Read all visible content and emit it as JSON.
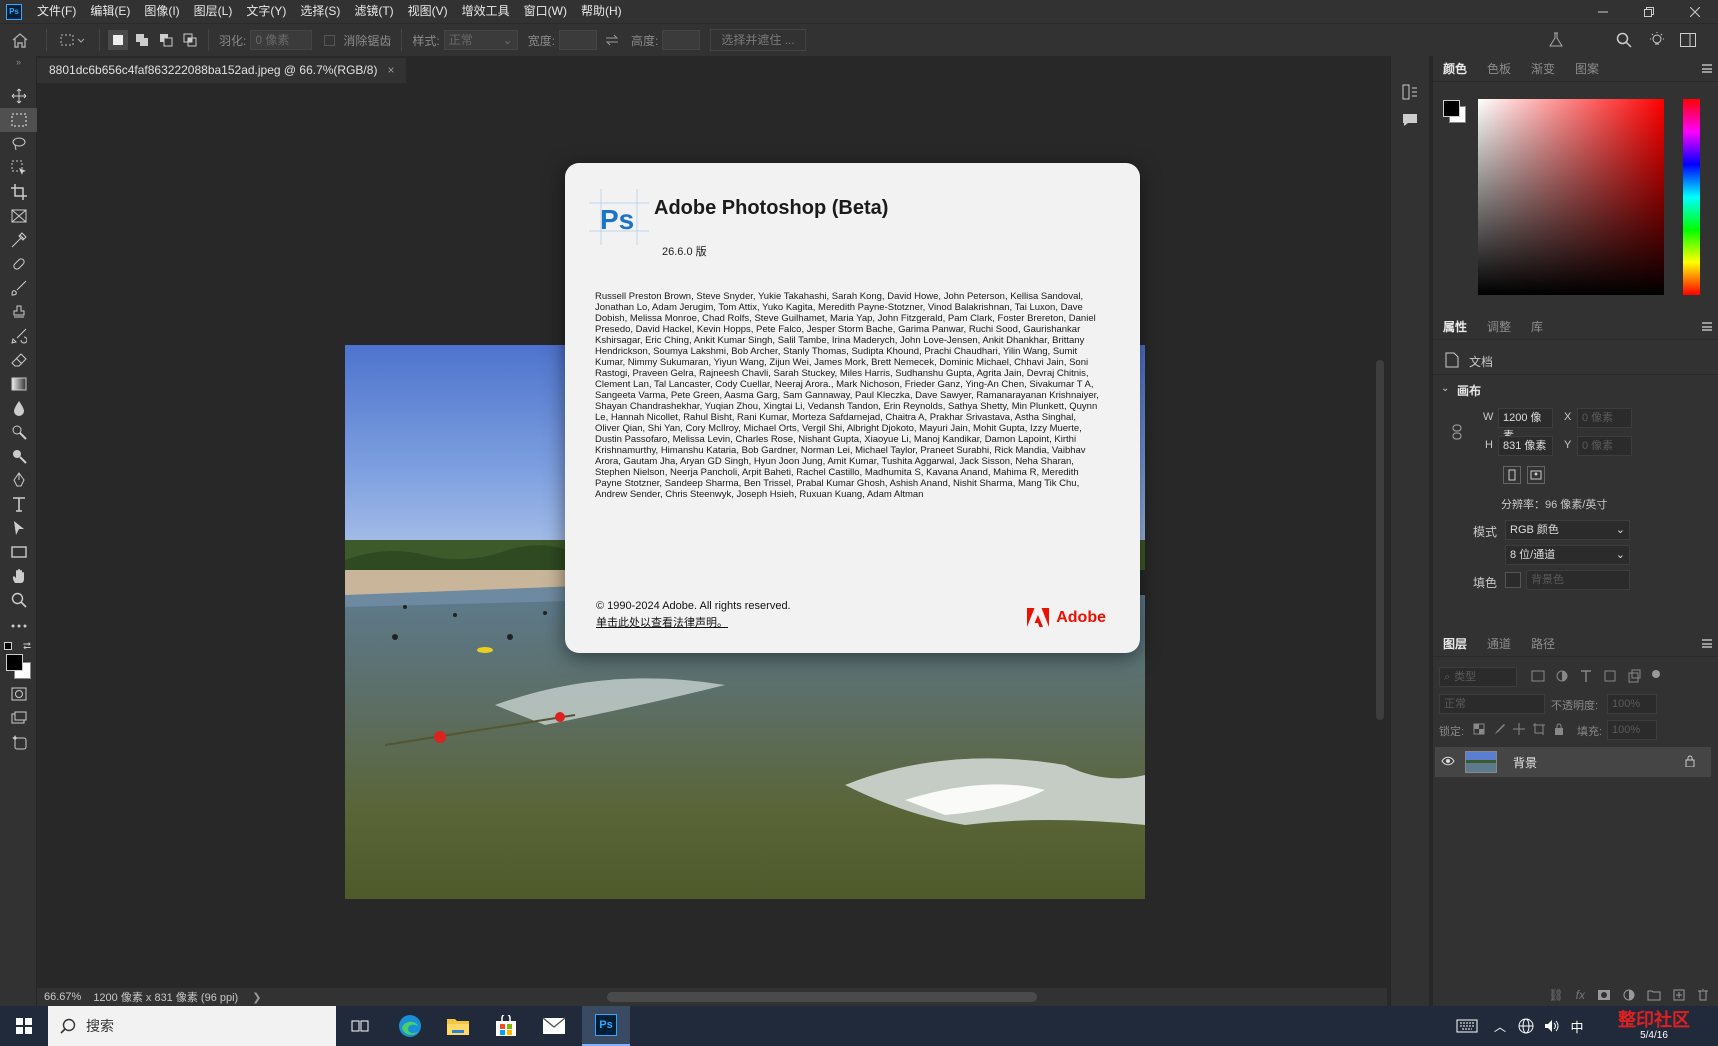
{
  "menubar": {
    "items": [
      "文件(F)",
      "编辑(E)",
      "图像(I)",
      "图层(L)",
      "文字(Y)",
      "选择(S)",
      "滤镜(T)",
      "视图(V)",
      "增效工具",
      "窗口(W)",
      "帮助(H)"
    ]
  },
  "options": {
    "feather_label": "羽化:",
    "feather_value": "0 像素",
    "antialias_label": "消除锯齿",
    "style_label": "样式:",
    "style_value": "正常",
    "width_label": "宽度:",
    "height_label": "高度:",
    "select_mask": "选择并遮住 ..."
  },
  "document": {
    "tab_title": "8801dc6b656c4faf863222088ba152ad.jpeg @ 66.7%(RGB/8)",
    "close": "×"
  },
  "status": {
    "zoom": "66.67%",
    "info": "1200 像素 x 831 像素 (96 ppi)",
    "arrow": "❯"
  },
  "about": {
    "logo_text": "Ps",
    "title": "Adobe Photoshop (Beta)",
    "version": "26.6.0 版",
    "credits": "Russell Preston Brown, Steve Snyder, Yukie Takahashi, Sarah Kong, David Howe, John Peterson, Kellisa Sandoval, Jonathan Lo, Adam Jerugim, Tom Attix, Yuko Kagita, Meredith Payne-Stotzner, Vinod Balakrishnan, Tai Luxon, Dave Dobish, Melissa Monroe, Chad Rolfs, Steve Guilhamet, Maria Yap, John Fitzgerald, Pam Clark, Foster Brereton, Daniel Presedo, David Hackel, Kevin Hopps, Pete Falco, Jesper Storm Bache, Garima Panwar, Ruchi Sood, Gaurishankar Kshirsagar, Eric Ching, Ankit Kumar Singh, Salil Tambe, Irina Maderych, John Love-Jensen, Ankit Dhankhar, Brittany Hendrickson, Soumya Lakshmi, Bob Archer, Stanly Thomas, Sudipta Khound, Prachi Chaudhari, Yilin Wang, Sumit Kumar, Nimmy Sukumaran, Yiyun Wang, Zijun Wei, James Mork, Brett Nemecek, Dominic Michael, Chhavi Jain, Soni Rastogi, Praveen Gelra, Rajneesh Chavli, Sarah Stuckey, Miles Harris, Sudhanshu Gupta, Agrita Jain, Devraj Chitnis, Clement Lan, Tal Lancaster, Cody Cuellar, Neeraj Arora., Mark Nichoson, Frieder Ganz, Ying-An Chen, Sivakumar T A, Sangeeta Varma, Pete Green, Aasma Garg, Sam Gannaway, Paul Kleczka, Dave Sawyer, Ramanarayanan Krishnaiyer, Shayan Chandrashekhar, Yuqian Zhou, Xingtai Li, Vedansh Tandon, Erin Reynolds, Sathya Shetty, Min Plunkett, Quynn Le, Hannah Nicollet, Rahul Bisht, Rani Kumar, Morteza Safdarnejad, Chaitra A, Prakhar Srivastava, Astha Singhal, Oliver Qian, Shi Yan, Cory McIlroy, Michael Orts, Vergil Shi, Albright Djokoto, Mayuri Jain, Mohit Gupta, Izzy Muerte, Dustin Passofaro, Melissa Levin, Charles Rose, Nishant Gupta, Xiaoyue Li, Manoj Kandikar, Damon Lapoint, Kirthi Krishnamurthy, Himanshu Kataria, Bob Gardner, Norman Lei, Michael Taylor, Praneet Surabhi, Rick Mandia, Vaibhav Arora, Gautam Jha, Aryan GD Singh, Hyun Joon Jung, Amit Kumar, Tushita Aggarwal, Jack Sisson, Neha Sharan, Stephen Nielson, Neerja Pancholi, Arpit Baheti, Rachel Castillo, Madhumita S, Kavana Anand, Mahima R, Meredith Payne Stotzner, Sandeep Sharma, Ben Trissel, Prabal Kumar Ghosh, Ashish Anand, Nishit Sharma, Mang Tik Chu, Andrew Sender, Chris Steenwyk, Joseph Hsieh, Ruxuan Kuang, Adam Altman",
    "copyright": "© 1990-2024 Adobe. All rights reserved.",
    "legal_link": "单击此处以查看法律声明。",
    "brand": "Adobe"
  },
  "color_panel": {
    "tabs": [
      "颜色",
      "色板",
      "渐变",
      "图案"
    ]
  },
  "properties_panel": {
    "tabs": [
      "属性",
      "调整",
      "库"
    ],
    "doc_label": "文档",
    "canvas_label": "画布",
    "w_label": "W",
    "w_value": "1200 像素",
    "h_label": "H",
    "h_value": "831 像素",
    "x_label": "X",
    "x_value": "0 像素",
    "y_label": "Y",
    "y_value": "0 像素",
    "resolution": "分辨率：96 像素/英寸",
    "mode_label": "模式",
    "mode_value": "RGB 颜色",
    "depth_value": "8 位/通道",
    "fill_label": "填色",
    "fill_value": "背景色"
  },
  "layers_panel": {
    "tabs": [
      "图层",
      "通道",
      "路径"
    ],
    "filter_placeholder": "类型",
    "blend_mode": "正常",
    "opacity_label": "不透明度:",
    "opacity_value": "100%",
    "lock_label": "锁定:",
    "fill_label": "填充:",
    "fill_value": "100%",
    "layer_name": "背景"
  },
  "taskbar": {
    "search_placeholder": "搜索",
    "ime": "中",
    "watermark": "整印社区",
    "date_partial": "5/4/16"
  },
  "colors": {
    "accent": "#31a8ff",
    "adobe_red": "#eb1000",
    "panel": "#323232",
    "canvas": "#282828"
  }
}
